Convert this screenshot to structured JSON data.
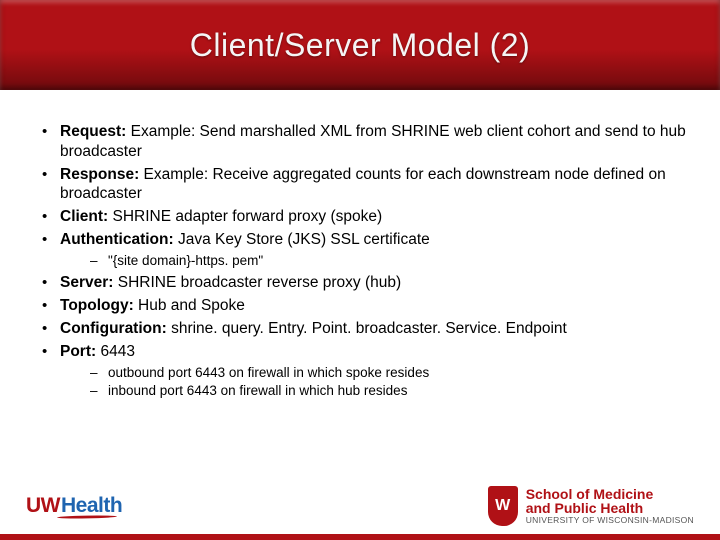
{
  "title": "Client/Server Model (2)",
  "bullets": {
    "b1_label": "Request:",
    "b1_text": " Example: Send marshalled XML from SHRINE web client cohort and send to hub broadcaster",
    "b2_label": "Response:",
    "b2_text": " Example: Receive aggregated counts for each downstream node defined on broadcaster",
    "b3_label": "Client:",
    "b3_text": " SHRINE adapter forward proxy (spoke)",
    "b4_label": "Authentication:",
    "b4_text": " Java Key Store (JKS) SSL certificate",
    "b4_sub1": "\"{site domain}-https. pem\"",
    "b5_label": "Server:",
    "b5_text": " SHRINE broadcaster reverse proxy (hub)",
    "b6_label": "Topology:",
    "b6_text": " Hub and Spoke",
    "b7_label": "Configuration:",
    "b7_text": " shrine. query. Entry. Point. broadcaster. Service. Endpoint",
    "b8_label": "Port:",
    "b8_text": " 6443",
    "b8_sub1": "outbound port 6443 on firewall in which spoke resides",
    "b8_sub2": "inbound port 6443 on firewall in which hub resides"
  },
  "footer": {
    "uw": "UW",
    "health": "Health",
    "smph_line1": "School of Medicine",
    "smph_line2": "and Public Health",
    "smph_line3": "UNIVERSITY OF WISCONSIN-MADISON"
  }
}
